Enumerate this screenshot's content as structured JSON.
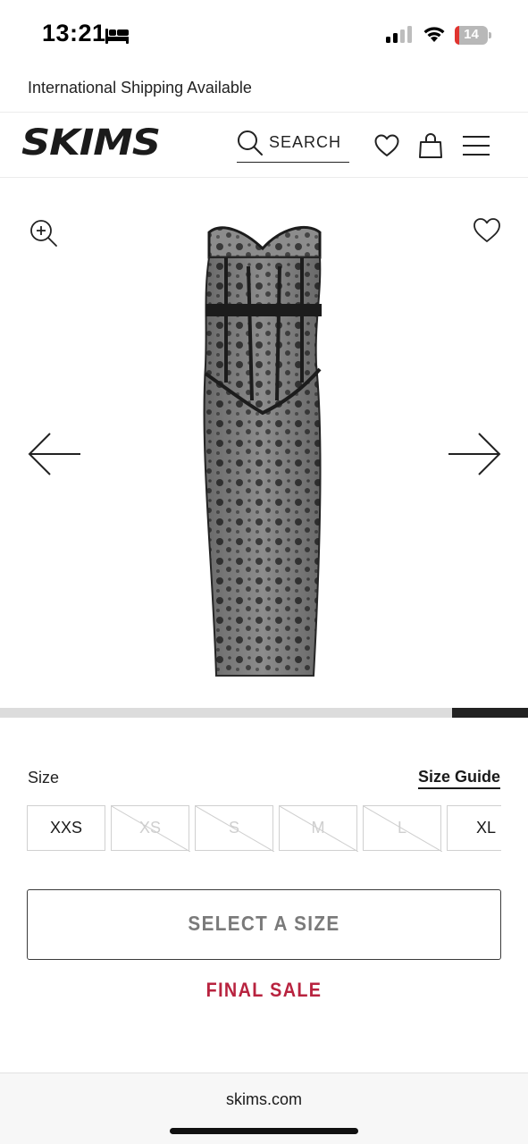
{
  "status_bar": {
    "time": "13:21",
    "battery_level": "14",
    "icons": [
      "bed-icon",
      "signal-icon",
      "wifi-icon",
      "battery-icon"
    ]
  },
  "banner": {
    "text": "International Shipping Available"
  },
  "header": {
    "logo": "SKIMS",
    "search_label": "SEARCH",
    "icons": [
      "search-icon",
      "heart-icon",
      "shopping-bag-icon",
      "hamburger-menu-icon"
    ]
  },
  "gallery": {
    "icons": [
      "zoom-in-icon",
      "wishlist-heart-icon",
      "arrow-left-icon",
      "arrow-right-icon"
    ],
    "image": "black lace strapless corset maxi dress",
    "scroll_progress": {
      "start": 0.857,
      "end": 1.0
    }
  },
  "size_selector": {
    "label": "Size",
    "guide_link": "Size Guide",
    "options": [
      {
        "label": "XXS",
        "available": true
      },
      {
        "label": "XS",
        "available": false
      },
      {
        "label": "S",
        "available": false
      },
      {
        "label": "M",
        "available": false
      },
      {
        "label": "L",
        "available": false
      },
      {
        "label": "XL",
        "available": true
      }
    ]
  },
  "actions": {
    "select_button": "SELECT A SIZE",
    "final_sale": "FINAL SALE"
  },
  "browser": {
    "url": "skims.com"
  },
  "colors": {
    "final_sale": "#b8233f",
    "button_text": "#7a7a7a",
    "unavailable_size": "#cfcfcf",
    "battery_low": "#e0342f"
  }
}
